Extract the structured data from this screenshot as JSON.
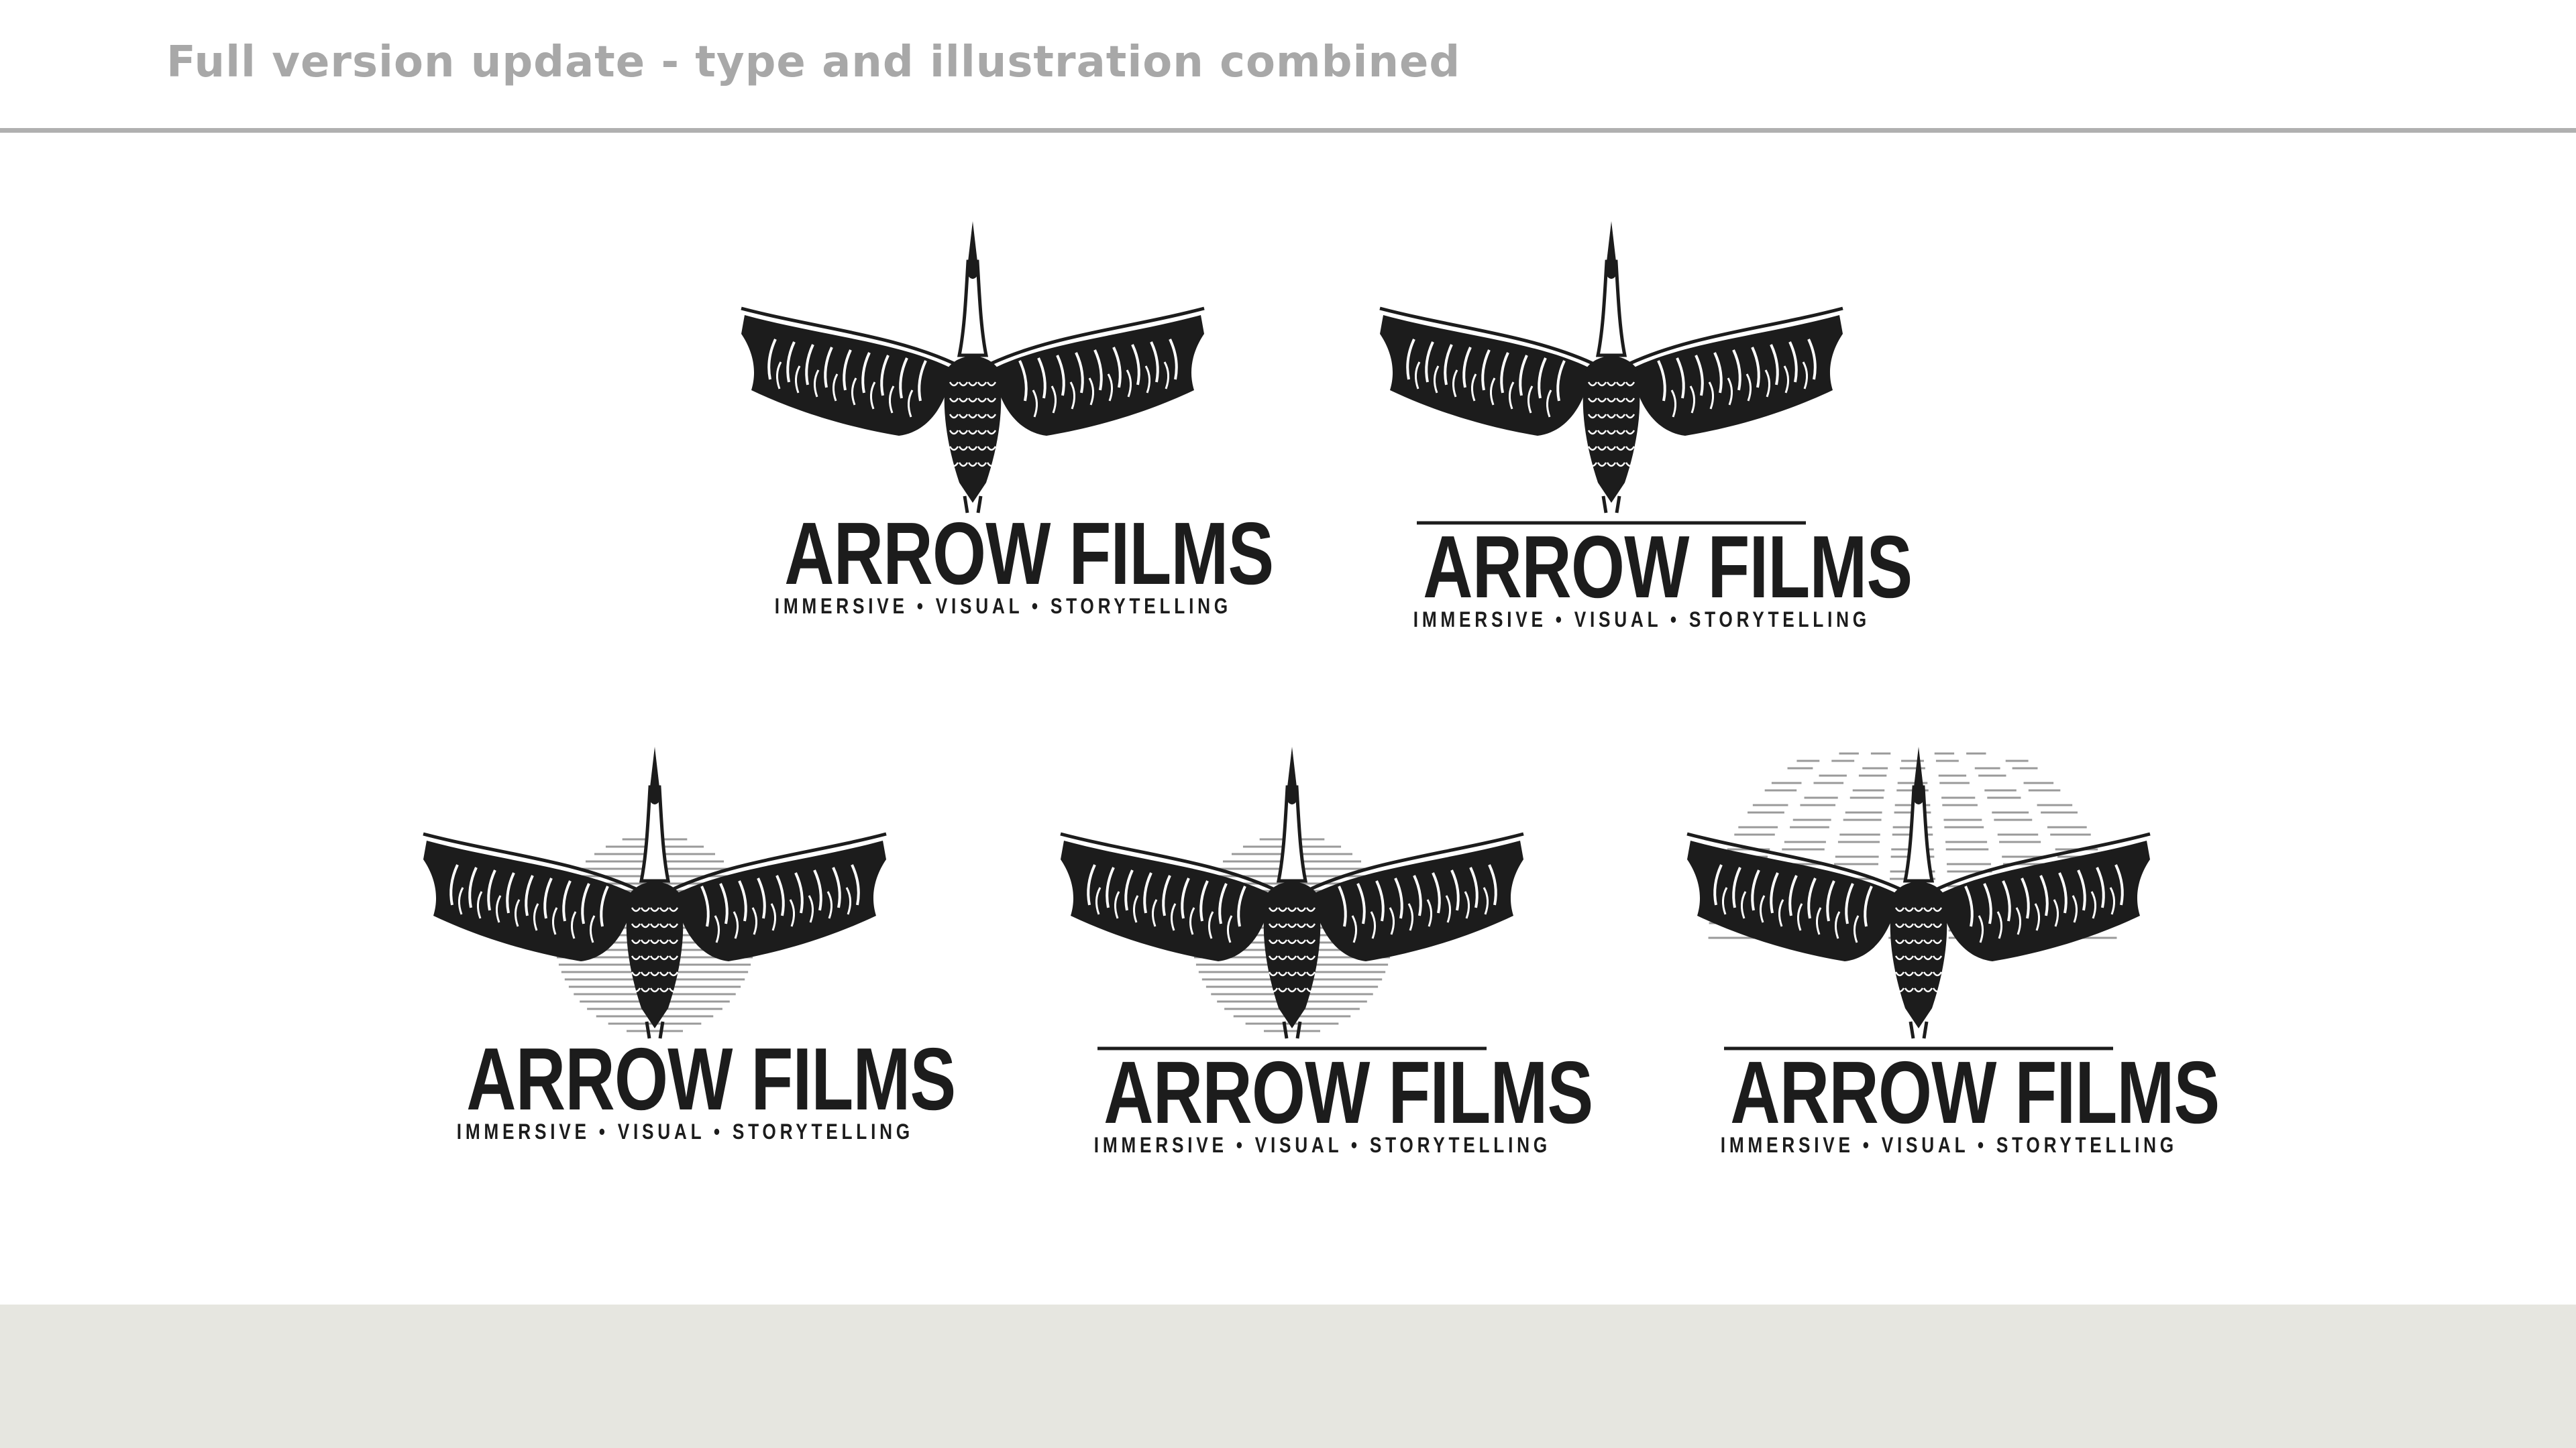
{
  "header": {
    "title": "Full version update - type and illustration combined"
  },
  "colors": {
    "ink": "#1c1c1c",
    "header_text": "#a8a8a8",
    "rule": "#b0b0b0",
    "footer_bg": "#e6e6e0",
    "halo": "#9a9a9a"
  },
  "logos": [
    {
      "variant": "plain",
      "name": "ARROW FILMS",
      "tagline": "IMMERSIVE • VISUAL • STORYTELLING"
    },
    {
      "variant": "underline",
      "name": "ARROW FILMS",
      "tagline": "IMMERSIVE • VISUAL • STORYTELLING"
    },
    {
      "variant": "sun",
      "name": "ARROW FILMS",
      "tagline": "IMMERSIVE • VISUAL • STORYTELLING"
    },
    {
      "variant": "sun-underline",
      "name": "ARROW FILMS",
      "tagline": "IMMERSIVE • VISUAL • STORYTELLING"
    },
    {
      "variant": "rays-underline",
      "name": "ARROW FILMS",
      "tagline": "IMMERSIVE • VISUAL • STORYTELLING"
    }
  ]
}
